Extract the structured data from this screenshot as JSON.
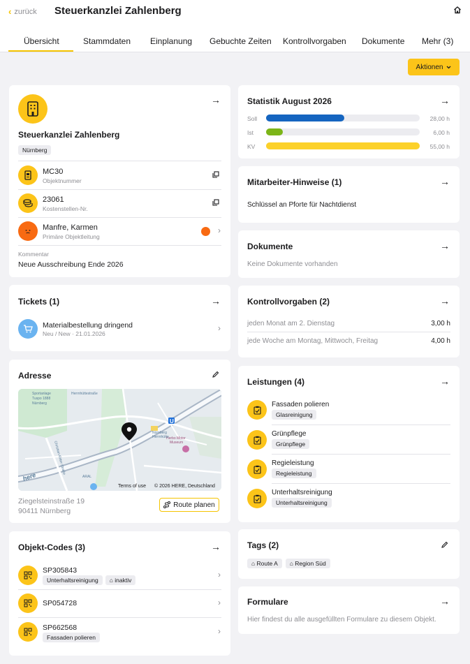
{
  "header": {
    "back_label": "zurück",
    "title": "Steuerkanzlei Zahlenberg"
  },
  "tabs": [
    {
      "label": "Übersicht"
    },
    {
      "label": "Stammdaten"
    },
    {
      "label": "Einplanung"
    },
    {
      "label": "Gebuchte Zeiten"
    },
    {
      "label": "Kontrollvorgaben"
    },
    {
      "label": "Dokumente"
    },
    {
      "label": "Mehr (3)"
    }
  ],
  "actions_label": "Aktionen",
  "object": {
    "name": "Steuerkanzlei Zahlenberg",
    "location_chip": "Nürnberg",
    "object_number": "MC30",
    "object_number_label": "Objektnummer",
    "cost_center": "23061",
    "cost_center_label": "Kostenstellen-Nr.",
    "manager": "Manfre, Karmen",
    "manager_label": "Primäre Objektleitung",
    "comment_label": "Kommentar",
    "comment": "Neue Ausschreibung Ende 2026"
  },
  "tickets": {
    "title": "Tickets (1)",
    "items": [
      {
        "title": "Materialbestellung dringend",
        "meta": "Neu / New · 21.01.2026"
      }
    ]
  },
  "address": {
    "title": "Adresse",
    "street": "Ziegelsteinstraße 19",
    "city": "90411 Nürnberg",
    "route_label": "Route planen",
    "map": {
      "terms": "Terms of use",
      "copyright": "© 2026 HERE, Deutschland",
      "logo": "here",
      "labels": [
        "Sportanlage Tuspo 1888 Nürnberg",
        "Herrnhütterstraße",
        "Christian-Ritter-Straße",
        "Herbo Motor Museum",
        "Nürnberg Herrnhütte",
        "ARAL"
      ]
    }
  },
  "codes": {
    "title": "Objekt-Codes (3)",
    "items": [
      {
        "code": "SP305843",
        "chips": [
          "Unterhaltsreinigung"
        ],
        "tag": "inaktiv"
      },
      {
        "code": "SP054728",
        "chips": [],
        "tag": ""
      },
      {
        "code": "SP662568",
        "chips": [
          "Fassaden polieren"
        ],
        "tag": ""
      }
    ]
  },
  "stats": {
    "title": "Statistik August 2026",
    "rows": [
      {
        "label": "Soll",
        "value": "28,00 h",
        "fraction": 0.51,
        "color": "#1565c0"
      },
      {
        "label": "Ist",
        "value": "6,00 h",
        "fraction": 0.11,
        "color": "#7cb518"
      },
      {
        "label": "KV",
        "value": "55,00 h",
        "fraction": 1.0,
        "color": "#fcd12a"
      }
    ]
  },
  "hints": {
    "title": "Mitarbeiter-Hinweise (1)",
    "text": "Schlüssel an Pforte für Nachtdienst"
  },
  "documents": {
    "title": "Dokumente",
    "empty": "Keine Dokumente vorhanden"
  },
  "controls": {
    "title": "Kontrollvorgaben (2)",
    "rows": [
      {
        "label": "jeden Monat am 2. Dienstag",
        "value": "3,00 h"
      },
      {
        "label": "jede Woche am Montag, Mittwoch, Freitag",
        "value": "4,00 h"
      }
    ]
  },
  "services": {
    "title": "Leistungen (4)",
    "items": [
      {
        "name": "Fassaden polieren",
        "chip": "Glasreinigung"
      },
      {
        "name": "Grünpflege",
        "chip": "Grünpflege"
      },
      {
        "name": "Regieleistung",
        "chip": "Regieleistung"
      },
      {
        "name": "Unterhaltsreinigung",
        "chip": "Unterhaltsreinigung"
      }
    ]
  },
  "tags": {
    "title": "Tags (2)",
    "items": [
      "Route A",
      "Region Süd"
    ]
  },
  "forms": {
    "title": "Formulare",
    "text": "Hier findest du alle ausgefüllten Formulare zu diesem Objekt."
  },
  "colors": {
    "accent": "#fcc419",
    "background": "#f2f2f5"
  }
}
